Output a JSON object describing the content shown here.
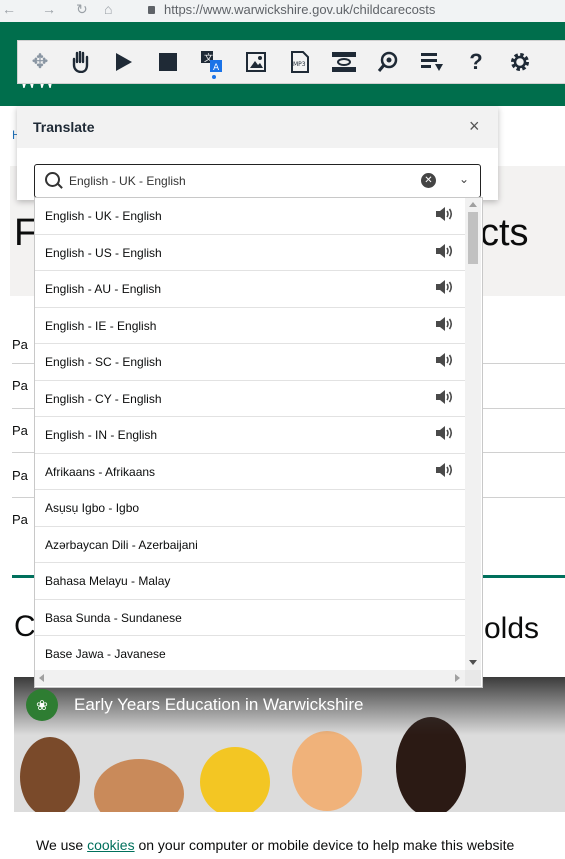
{
  "browser": {
    "url": "https://www.warwickshire.gov.uk/childcarecosts"
  },
  "toolbar": {
    "tools": [
      "move-icon",
      "hand-icon",
      "play-icon",
      "stop-icon",
      "translate-icon",
      "picture-icon",
      "mp3-icon",
      "screen-mask-icon",
      "magnifier-icon",
      "text-simplify-icon",
      "help-icon",
      "settings-icon"
    ],
    "mp3_label": "MP3"
  },
  "page": {
    "hero_title_tail": "cts",
    "hero_title_head": "F",
    "rows_prefix": [
      "Pa",
      "Pa",
      "Pa",
      "Pa",
      "Pa"
    ],
    "section_heading_left": "C",
    "section_heading_right": "r-olds",
    "video_title": "Early Years Education in Warwickshire",
    "cookie_before": "We use ",
    "cookie_link": "cookies",
    "cookie_after": " on your computer or mobile device to help make this website"
  },
  "translate": {
    "title": "Translate",
    "close": "×",
    "search_value": "English - UK - English",
    "languages": [
      {
        "label": "English - UK - English",
        "audio": true
      },
      {
        "label": "English - US - English",
        "audio": true
      },
      {
        "label": "English - AU - English",
        "audio": true
      },
      {
        "label": "English - IE - English",
        "audio": true
      },
      {
        "label": "English - SC - English",
        "audio": true
      },
      {
        "label": "English - CY - English",
        "audio": true
      },
      {
        "label": "English - IN - English",
        "audio": true
      },
      {
        "label": "Afrikaans - Afrikaans",
        "audio": true
      },
      {
        "label": "Asụsụ Igbo - Igbo",
        "audio": false
      },
      {
        "label": "Azərbaycan Dili - Azerbaijani",
        "audio": false
      },
      {
        "label": "Bahasa Melayu - Malay",
        "audio": false
      },
      {
        "label": "Basa Sunda - Sundanese",
        "audio": false
      },
      {
        "label": "Base Jawa - Javanese",
        "audio": false
      }
    ]
  },
  "colors": {
    "header_green": "#006e4c",
    "accent_teal": "#00705c",
    "selected_tool_dot": "#1a73e8"
  }
}
